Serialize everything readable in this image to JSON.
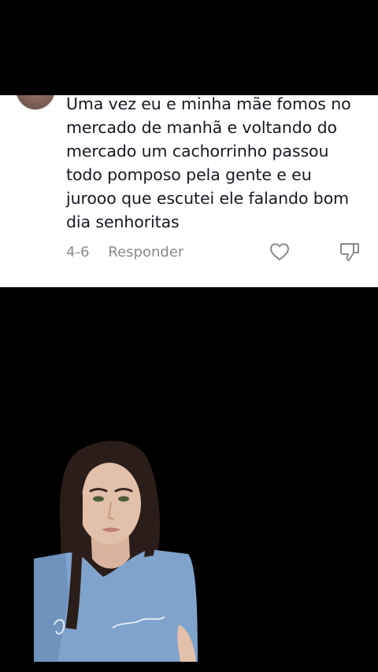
{
  "comment": {
    "text": "Uma vez eu e minha mãe fomos no mercado de manhã e voltando do mercado um cachorrinho passou todo pomposo pela gente e eu jurooo que escutei ele falando bom dia senhoritas",
    "date": "4-6",
    "reply_label": "Responder",
    "like_icon": "heart-outline-icon",
    "dislike_icon": "thumbs-down-outline-icon"
  },
  "colors": {
    "background": "#000000",
    "card": "#ffffff",
    "text": "#161823",
    "muted": "#8a8b91"
  }
}
